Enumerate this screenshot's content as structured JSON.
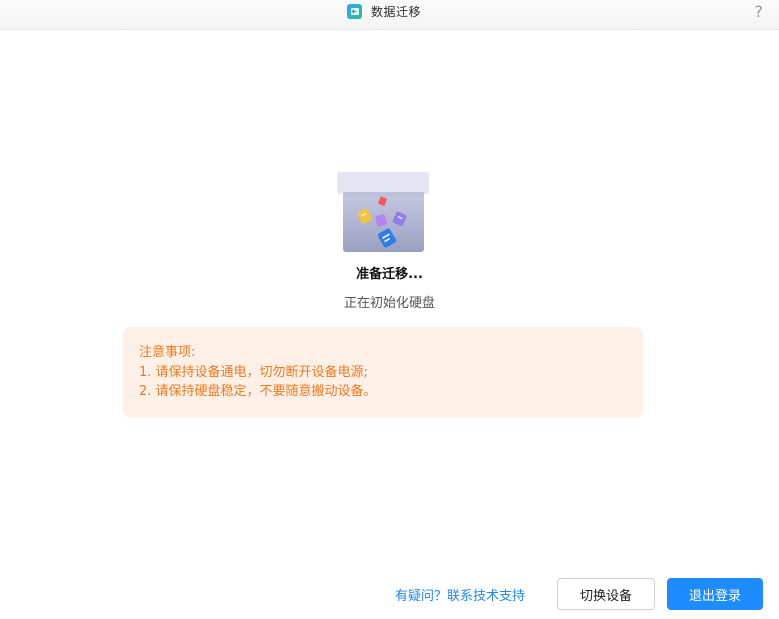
{
  "window": {
    "title": "数据迁移",
    "help_label": "?"
  },
  "status": {
    "title": "准备迁移...",
    "subtitle": "正在初始化硬盘"
  },
  "notice": {
    "heading": "注意事项:",
    "items": [
      "1. 请保持设备通电，切勿断开设备电源;",
      "2. 请保持硬盘稳定，不要随意搬动设备。"
    ]
  },
  "footer": {
    "support_link": "有疑问？联系技术支持",
    "switch_button": "切换设备",
    "logout_button": "退出登录"
  },
  "colors": {
    "accent": "#1e8bff",
    "link": "#1e87f0",
    "notice_bg": "#fef0e6",
    "notice_text": "#ef7a1e"
  },
  "icons": {
    "app": "data-migration-app-icon",
    "help": "question-mark-icon",
    "illustration": "migration-box-illustration"
  }
}
